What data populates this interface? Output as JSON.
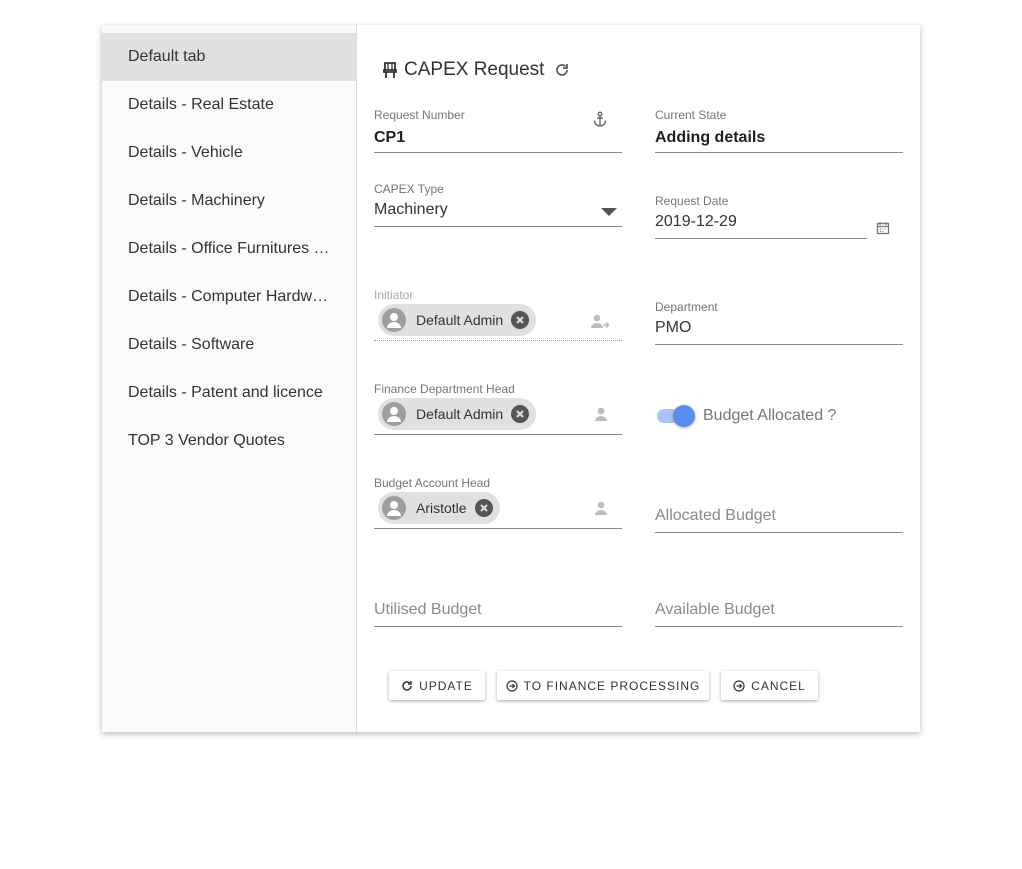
{
  "sidebar": {
    "items": [
      {
        "label": "Default tab",
        "active": true
      },
      {
        "label": "Details - Real Estate"
      },
      {
        "label": "Details - Vehicle"
      },
      {
        "label": "Details - Machinery"
      },
      {
        "label": "Details - Office Furnitures a..."
      },
      {
        "label": "Details - Computer Hardwa..."
      },
      {
        "label": "Details - Software"
      },
      {
        "label": "Details - Patent and licence"
      },
      {
        "label": "TOP 3 Vendor Quotes"
      }
    ]
  },
  "form": {
    "title": "CAPEX Request",
    "title_icon": "chair-icon",
    "refresh_icon": "refresh-icon",
    "request_number": {
      "label": "Request Number",
      "value": "CP1",
      "icon": "anchor-icon"
    },
    "current_state": {
      "label": "Current State",
      "value": "Adding details"
    },
    "capex_type": {
      "label": "CAPEX Type",
      "value": "Machinery"
    },
    "request_date": {
      "label": "Request Date",
      "value": "2019-12-29",
      "icon": "calendar-icon"
    },
    "initiator": {
      "label": "Initiator",
      "chip": "Default Admin",
      "icon": "user-arrow-icon"
    },
    "department": {
      "label": "Department",
      "value": "PMO"
    },
    "finance_head": {
      "label": "Finance Department Head",
      "chip": "Default Admin",
      "icon": "user-icon"
    },
    "budget_allocated": {
      "label": "Budget Allocated ?",
      "on": true
    },
    "budget_account_head": {
      "label": "Budget Account Head",
      "chip": "Aristotle",
      "icon": "user-icon"
    },
    "allocated_budget": {
      "placeholder": "Allocated Budget"
    },
    "utilised_budget": {
      "placeholder": "Utilised Budget"
    },
    "available_budget": {
      "placeholder": "Available Budget"
    }
  },
  "actions": {
    "update": "UPDATE",
    "finance": "TO FINANCE PROCESSING",
    "cancel": "CANCEL"
  },
  "colors": {
    "accent": "#5b8def",
    "accent_light": "#a9c4f5",
    "sidebar_active": "#e0e0e0"
  }
}
